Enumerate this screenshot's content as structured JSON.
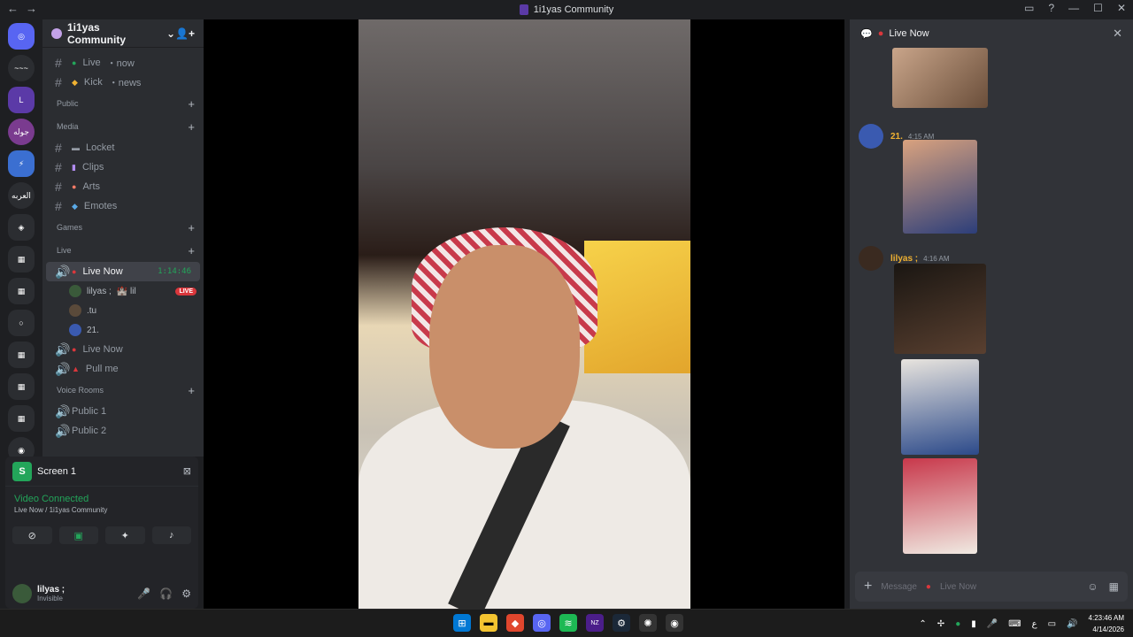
{
  "window": {
    "title": "1i1yas Community",
    "back": "←",
    "forward": "→",
    "min": "—",
    "max": "☐",
    "close": "✕",
    "inbox": "▭",
    "help": "?"
  },
  "guilds": {
    "items": [
      "◎",
      "~~~",
      "L",
      "جوله",
      "⚡",
      "العربه",
      "◈",
      "▦",
      "▦",
      "○",
      "▦",
      "▦",
      "▦",
      "◉"
    ]
  },
  "server": {
    "name": "1i1yas Community",
    "chev": "⌄",
    "invite": "👤+"
  },
  "channels": {
    "live": {
      "label": "Live",
      "suffix": "now"
    },
    "kick": {
      "label": "Kick",
      "suffix": "news"
    },
    "public_cat": "Public",
    "media_cat": "Media",
    "locket": "Locket",
    "clips": "Clips",
    "arts": "Arts",
    "emotes": "Emotes",
    "games_cat": "Games",
    "live_cat": "Live",
    "live_now": "Live Now",
    "live_now_timer": "1:14:46",
    "voice_users": [
      {
        "name": "lilyas ;",
        "badges": "🏰 lil",
        "live": "LIVE"
      },
      {
        "name": ".tu"
      },
      {
        "name": "21."
      }
    ],
    "live_now_2": "Live Now",
    "pull_me": "Pull me",
    "voice_rooms_cat": "Voice Rooms",
    "public1": "Public 1",
    "public2": "Public 2"
  },
  "panel": {
    "screen_label": "Screen 1",
    "screen_icon": "S",
    "video_connected": "Video Connected",
    "location": "Live Now / 1i1yas Community",
    "username": "lilyas ;",
    "status": "Invisible"
  },
  "chat": {
    "header": "Live Now",
    "messages": [
      {
        "name": "21.",
        "time": "4:15 AM"
      },
      {
        "name": "lilyas ;",
        "time": "4:16 AM"
      }
    ],
    "placeholder": "Message",
    "placeholder_channel": "Live Now"
  },
  "taskbar": {
    "time": "4:23:46 AM",
    "date": "4/14/2026",
    "lang": "ع"
  },
  "colors": {
    "accent": "#23a55a",
    "live": "#da373c",
    "bg": "#1e1f22"
  }
}
